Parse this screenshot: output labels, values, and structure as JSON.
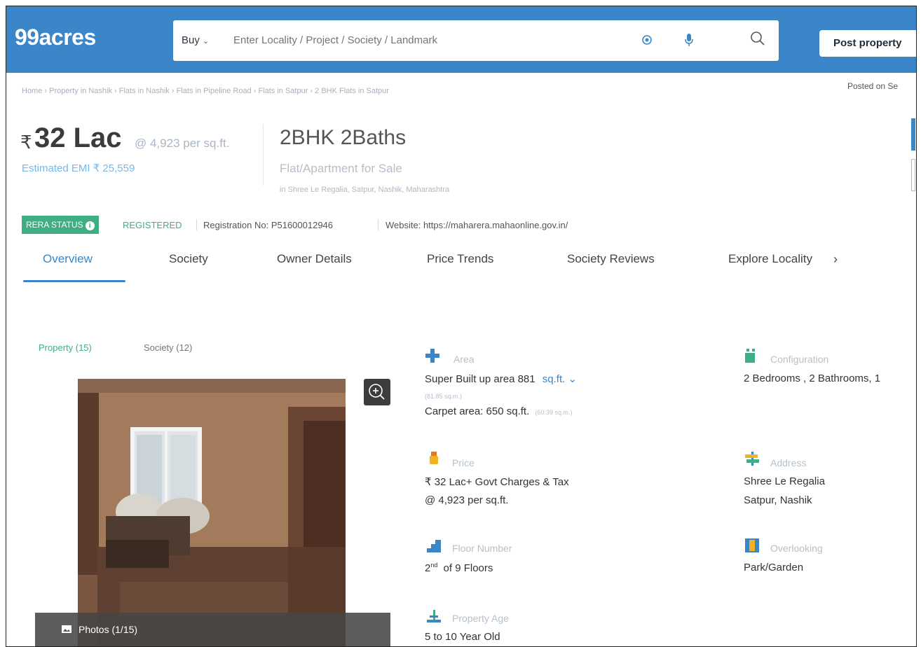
{
  "header": {
    "logo": "99acres",
    "buy_label": "Buy",
    "search_placeholder": "Enter Locality / Project / Society / Landmark",
    "post_property": "Post property"
  },
  "breadcrumb": "Home › Property in Nashik › Flats in Nashik › Flats in Pipeline Road › Flats in Satpur › 2 BHK Flats in Satpur",
  "posted_on": "Posted on Se",
  "listing": {
    "rupee": "₹",
    "price": "32 Lac",
    "price_per_sqft": "@ 4,923 per sq.ft.",
    "emi": "Estimated EMI ₹ 25,559",
    "title": "2BHK 2Baths",
    "type": "Flat/Apartment for Sale",
    "location": "in Shree Le Regalia, Satpur, Nashik, Maharashtra"
  },
  "rera": {
    "badge": "RERA STATUS",
    "status": "REGISTERED",
    "registration": "Registration No: P51600012946",
    "website": "Website: https://maharera.mahaonline.gov.in/"
  },
  "tabs": [
    "Overview",
    "Society",
    "Owner Details",
    "Price Trends",
    "Society Reviews",
    "Explore Locality"
  ],
  "media": {
    "property_tab": "Property (15)",
    "society_tab": "Society (12)",
    "photos_label": "Photos (1/15)"
  },
  "details": {
    "area": {
      "label": "Area",
      "super": "Super Built up area 881",
      "unit": "sq.ft.",
      "super_sqm": "(81.85 sq.m.)",
      "carpet": "Carpet area: 650 sq.ft.",
      "carpet_sqm": "(60.39 sq.m.)"
    },
    "configuration": {
      "label": "Configuration",
      "value": "2 Bedrooms , 2 Bathrooms, 1"
    },
    "price": {
      "label": "Price",
      "line1": "₹ 32 Lac+ Govt Charges & Tax",
      "line2": "@ 4,923 per sq.ft."
    },
    "address": {
      "label": "Address",
      "line1": "Shree Le Regalia",
      "line2": "Satpur, Nashik"
    },
    "floor": {
      "label": "Floor Number",
      "number": "2",
      "suffix": "nd",
      "of": "of 9 Floors"
    },
    "overlooking": {
      "label": "Overlooking",
      "value": "Park/Garden"
    },
    "age": {
      "label": "Property Age",
      "value": "5 to 10 Year Old"
    }
  },
  "colors": {
    "brand_blue": "#3a86c8",
    "rera_green": "#3fae82"
  }
}
